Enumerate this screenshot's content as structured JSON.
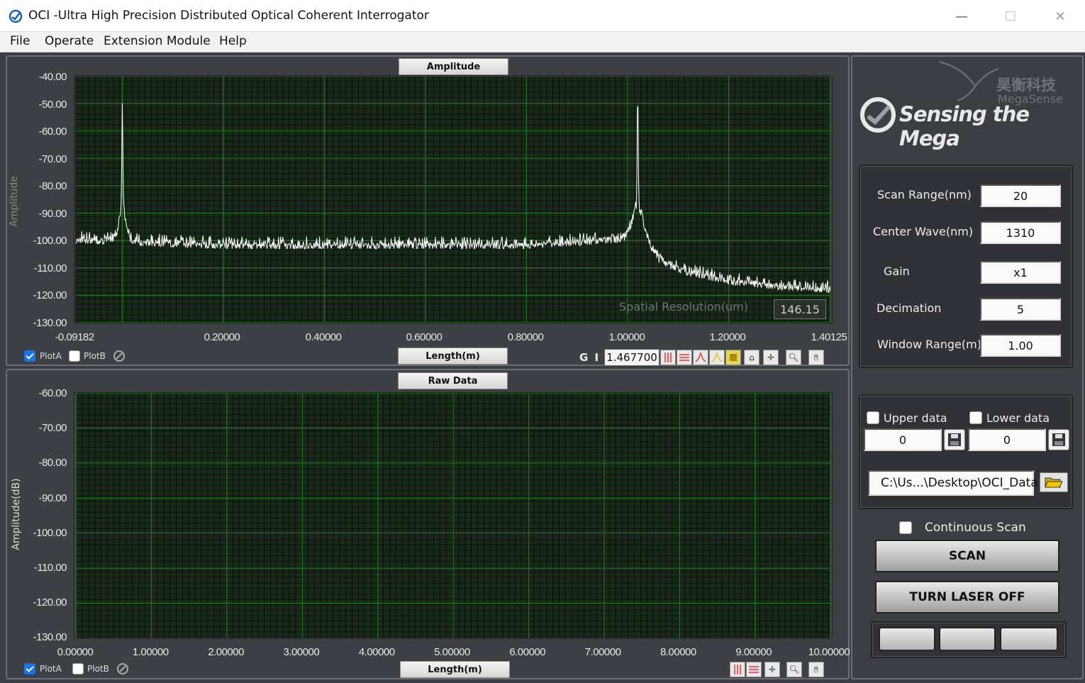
{
  "window": {
    "title": "OCI -Ultra High Precision Distributed Optical Coherent Interrogator",
    "minimize": "—",
    "maximize": "☐",
    "close": "✕"
  },
  "menu": [
    "File",
    "Operate",
    "Extension Module",
    "Help"
  ],
  "amplitude_graph": {
    "tab": "Amplitude",
    "ylabel": "Amplitude",
    "xlabel": "Length(m)",
    "yticks": [
      "-40.00",
      "-50.00",
      "-60.00",
      "-70.00",
      "-80.00",
      "-90.00",
      "-100.00",
      "-110.00",
      "-120.00",
      "-130.00"
    ],
    "xticks": [
      "-0.09182",
      "0.20000",
      "0.40000",
      "0.60000",
      "0.80000",
      "1.00000",
      "1.20000",
      "1.40125"
    ],
    "spatial_resolution_label": "Spatial Resolution(um)",
    "spatial_resolution_value": "146.15",
    "gi_label": "G I",
    "gi_value": "1.467700",
    "plotA": "PlotA",
    "plotB": "PlotB"
  },
  "raw_graph": {
    "tab": "Raw Data",
    "ylabel": "Amplitude(dB)",
    "xlabel": "Length(m)",
    "yticks": [
      "-60.00",
      "-70.00",
      "-80.00",
      "-90.00",
      "-100.00",
      "-110.00",
      "-120.00",
      "-130.00"
    ],
    "xticks": [
      "0.00000",
      "1.00000",
      "2.00000",
      "3.00000",
      "4.00000",
      "5.00000",
      "6.00000",
      "7.00000",
      "8.00000",
      "9.00000",
      "10.00000"
    ],
    "plotA": "PlotA",
    "plotB": "PlotB"
  },
  "chart_data": [
    {
      "type": "line",
      "title": "Amplitude",
      "xlabel": "Length(m)",
      "ylabel": "Amplitude",
      "xlim": [
        -0.09182,
        1.40125
      ],
      "ylim": [
        -130,
        -40
      ],
      "grid": true,
      "series": [
        {
          "name": "PlotA",
          "color": "#ffffff",
          "x": [
            -0.09182,
            0.0,
            -0.002,
            0.002,
            0.05,
            0.2,
            0.4,
            0.6,
            0.8,
            0.98,
            1.0,
            1.02,
            1.1,
            1.2,
            1.3,
            1.40125
          ],
          "y": [
            -100,
            -85,
            -50,
            -85,
            -102,
            -103,
            -103,
            -103,
            -103,
            -98,
            -43,
            -95,
            -112,
            -116,
            -118,
            -119
          ]
        }
      ]
    },
    {
      "type": "line",
      "title": "Raw Data",
      "xlabel": "Length(m)",
      "ylabel": "Amplitude(dB)",
      "xlim": [
        0,
        10
      ],
      "ylim": [
        -130,
        -60
      ],
      "grid": true,
      "series": []
    }
  ],
  "side": {
    "brand_cn": "昊衡科技",
    "brand_en": "MegaSense",
    "slogan": "Sensing the Mega",
    "params": [
      {
        "label": "Scan Range(nm)",
        "value": "20"
      },
      {
        "label": "Center Wave(nm)",
        "value": "1310"
      },
      {
        "label": "Gain",
        "value": "x1"
      },
      {
        "label": "Decimation",
        "value": "5"
      },
      {
        "label": "Window Range(m)",
        "value": "1.00"
      }
    ],
    "upper_label": "Upper data",
    "lower_label": "Lower data",
    "upper_value": "0",
    "lower_value": "0",
    "path": "C:\\Us...\\Desktop\\OCI_Data",
    "continuous_label": "Continuous Scan",
    "scan_button": "SCAN",
    "laser_button": "TURN LASER OFF"
  },
  "colors": {
    "plot_bg": "#1a2a1a",
    "grid_major": "#1e7a1e",
    "trace": "#ffffff"
  }
}
